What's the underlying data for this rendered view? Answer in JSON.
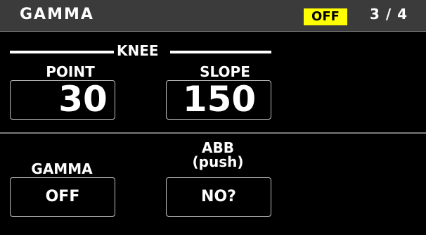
{
  "header": {
    "title": "GAMMA",
    "status": "OFF",
    "page": "3 / 4"
  },
  "knee": {
    "section_label": "KNEE",
    "point_label": "POINT",
    "point_value": "30",
    "slope_label": "SLOPE",
    "slope_value": "150"
  },
  "controls": {
    "gamma_label": "GAMMA",
    "gamma_value": "OFF",
    "abb_label_line1": "ABB",
    "abb_label_line2": "(push)",
    "abb_value": "NO?"
  },
  "colors": {
    "status_bg": "#ffff00",
    "header_bg": "#3b3b3b",
    "background": "#000000"
  }
}
